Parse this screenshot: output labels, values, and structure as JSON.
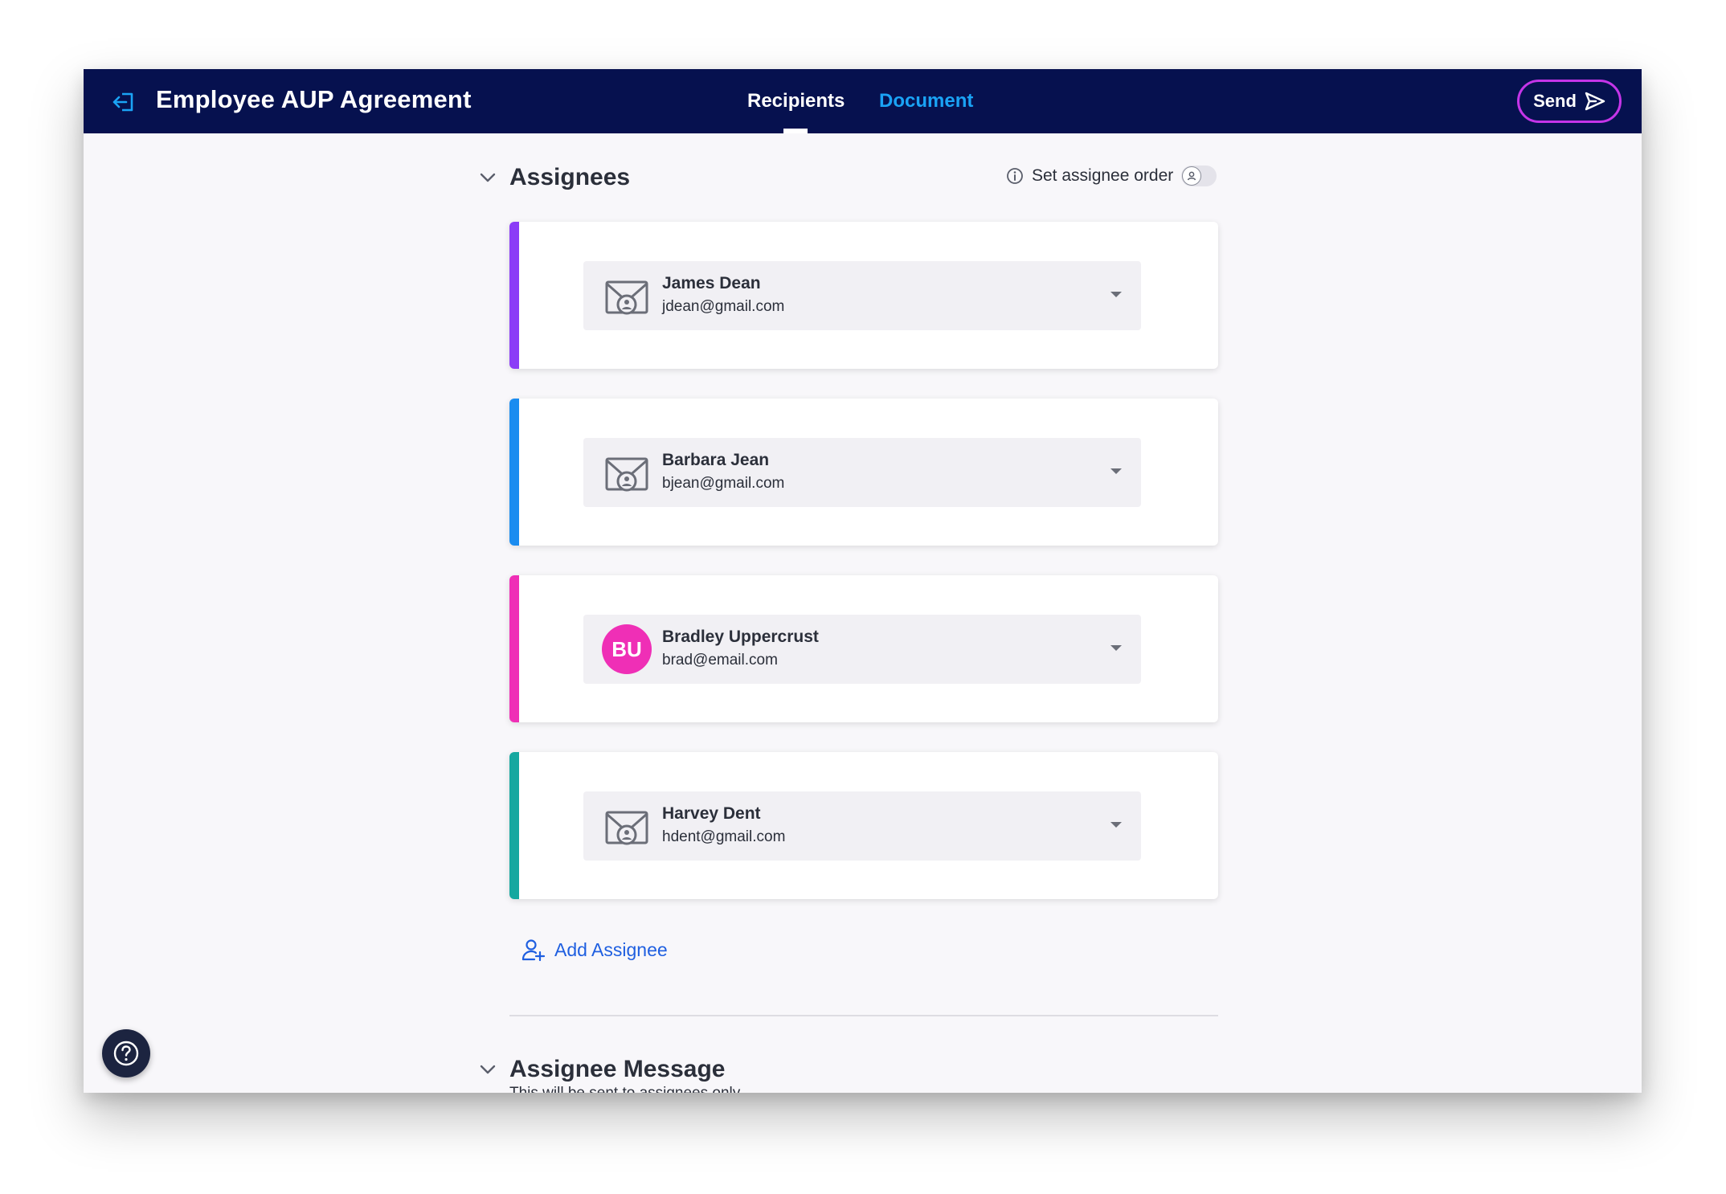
{
  "header": {
    "title": "Employee AUP Agreement",
    "tabs": [
      {
        "label": "Recipients",
        "active": true
      },
      {
        "label": "Document",
        "active": false
      }
    ],
    "send_label": "Send"
  },
  "assignees_section": {
    "title": "Assignees",
    "order_label": "Set assignee order",
    "order_enabled": false,
    "items": [
      {
        "name": "James Dean",
        "email": "jdean@gmail.com",
        "avatar_type": "mail-icon",
        "color": "#8b3cf7"
      },
      {
        "name": "Barbara Jean",
        "email": "bjean@gmail.com",
        "avatar_type": "mail-icon",
        "color": "#1a8cf0"
      },
      {
        "name": "Bradley Uppercrust",
        "email": "brad@email.com",
        "avatar_type": "initials",
        "initials": "BU",
        "color": "#ef2fb6"
      },
      {
        "name": "Harvey Dent",
        "email": "hdent@gmail.com",
        "avatar_type": "mail-icon",
        "color": "#16a8a0"
      }
    ],
    "add_label": "Add Assignee"
  },
  "message_section": {
    "title": "Assignee Message",
    "subtitle": "This will be sent to assignees only"
  },
  "colors": {
    "nav_bg": "#06114f",
    "link_blue": "#1f5fe0",
    "send_border": "#c535e8"
  }
}
